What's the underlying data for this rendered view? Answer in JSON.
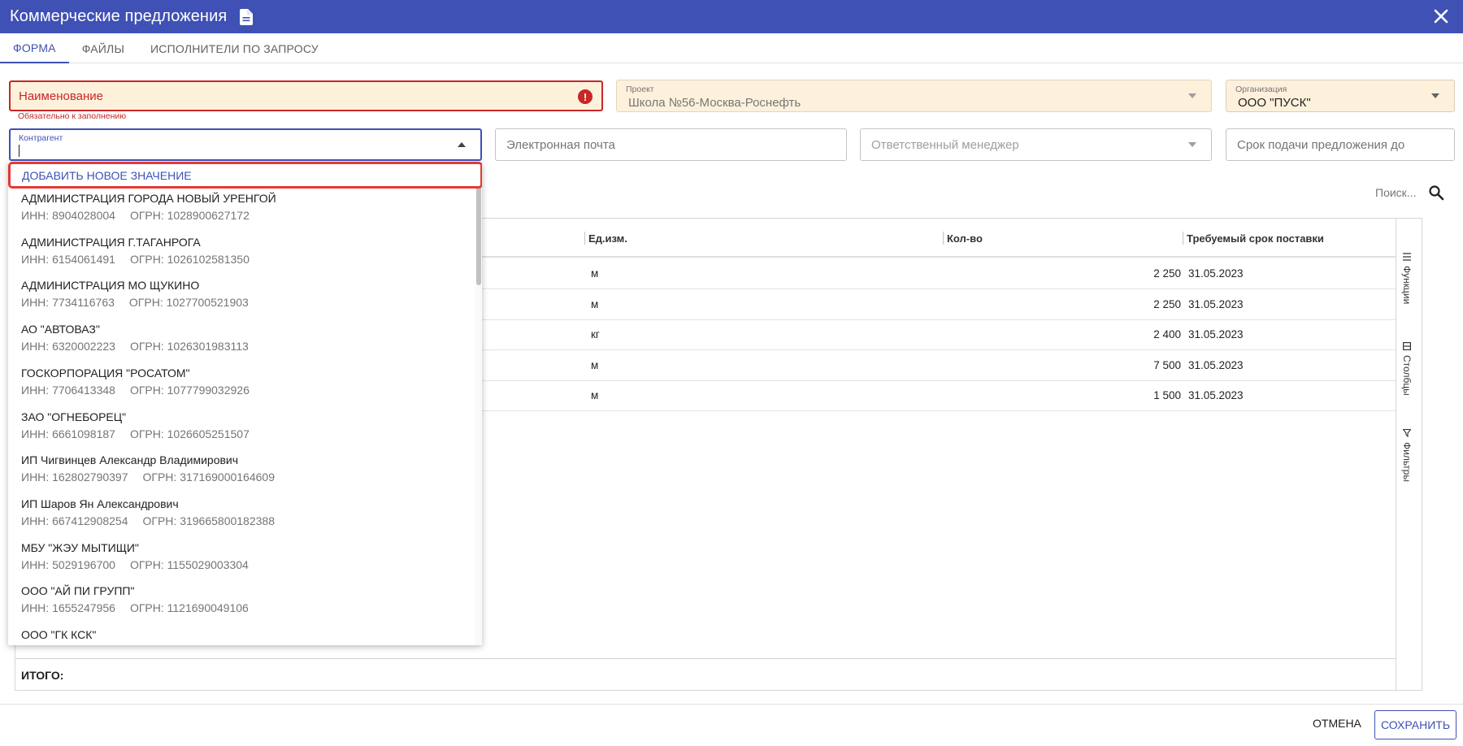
{
  "window": {
    "title": "Коммерческие предложения"
  },
  "tabs": [
    {
      "label": "ФОРМА",
      "active": true
    },
    {
      "label": "ФАЙЛЫ"
    },
    {
      "label": "ИСПОЛНИТЕЛИ ПО ЗАПРОСУ"
    }
  ],
  "form": {
    "name_field": {
      "label": "Наименование",
      "helper": "Обязательно к заполнению",
      "error_icon": "!"
    },
    "project": {
      "label": "Проект",
      "value": "Школа №56-Москва-Роснефть"
    },
    "organization": {
      "label": "Организация",
      "value": "ООО \"ПУСК\""
    },
    "counterparty": {
      "label": "Контрагент",
      "value": ""
    },
    "email": {
      "placeholder": "Электронная почта"
    },
    "manager": {
      "placeholder": "Ответственный менеджер"
    },
    "deadline": {
      "placeholder": "Срок подачи предложения до"
    }
  },
  "search": {
    "placeholder": "Поиск..."
  },
  "dropdown": {
    "add_new_label": "ДОБАВИТЬ НОВОЕ ЗНАЧЕНИЕ",
    "options": [
      {
        "name": "АДМИНИСТРАЦИЯ ГОРОДА НОВЫЙ УРЕНГОЙ",
        "inn": "ИНН: 8904028004",
        "ogrn": "ОГРН: 1028900627172"
      },
      {
        "name": "АДМИНИСТРАЦИЯ Г.ТАГАНРОГА",
        "inn": "ИНН: 6154061491",
        "ogrn": "ОГРН: 1026102581350"
      },
      {
        "name": "АДМИНИСТРАЦИЯ МО ЩУКИНО",
        "inn": "ИНН: 7734116763",
        "ogrn": "ОГРН: 1027700521903"
      },
      {
        "name": "АО \"АВТОВАЗ\"",
        "inn": "ИНН: 6320002223",
        "ogrn": "ОГРН: 1026301983113"
      },
      {
        "name": "ГОСКОРПОРАЦИЯ \"РОСАТОМ\"",
        "inn": "ИНН: 7706413348",
        "ogrn": "ОГРН: 1077799032926"
      },
      {
        "name": "ЗАО \"ОГНЕБОРЕЦ\"",
        "inn": "ИНН: 6661098187",
        "ogrn": "ОГРН: 1026605251507"
      },
      {
        "name": "ИП Чигвинцев Александр Владимирович",
        "inn": "ИНН: 162802790397",
        "ogrn": "ОГРН: 317169000164609"
      },
      {
        "name": "ИП Шаров Ян Александрович",
        "inn": "ИНН: 667412908254",
        "ogrn": "ОГРН: 319665800182388"
      },
      {
        "name": "МБУ \"ЖЭУ МЫТИЩИ\"",
        "inn": "ИНН: 5029196700",
        "ogrn": "ОГРН: 1155029003304"
      },
      {
        "name": "ООО \"АЙ ПИ ГРУПП\"",
        "inn": "ИНН: 1655247956",
        "ogrn": "ОГРН: 1121690049106"
      },
      {
        "name": "ООО \"ГК КСК\"",
        "inn": "",
        "ogrn": ""
      }
    ]
  },
  "table": {
    "columns": [
      "Ед.изм.",
      "Кол-во",
      "Требуемый срок поставки"
    ],
    "rows": [
      {
        "unit": "м",
        "qty": "2 250",
        "date": "31.05.2023"
      },
      {
        "unit": "м",
        "qty": "2 250",
        "date": "31.05.2023"
      },
      {
        "unit": "кг",
        "qty": "2 400",
        "date": "31.05.2023"
      },
      {
        "unit": "м",
        "qty": "7 500",
        "date": "31.05.2023"
      },
      {
        "unit": "м",
        "qty": "1 500",
        "date": "31.05.2023"
      }
    ],
    "total_label": "ИТОГО:"
  },
  "side_panel": {
    "functions": "Функции",
    "columns": "Столбцы",
    "filters": "Фильтры"
  },
  "footer": {
    "cancel": "ОТМЕНА",
    "save": "СОХРАНИТЬ"
  },
  "colors": {
    "primary": "#3f51b5",
    "error": "#c62828",
    "required_bg": "#fdf1dc",
    "highlight": "#e53935"
  }
}
